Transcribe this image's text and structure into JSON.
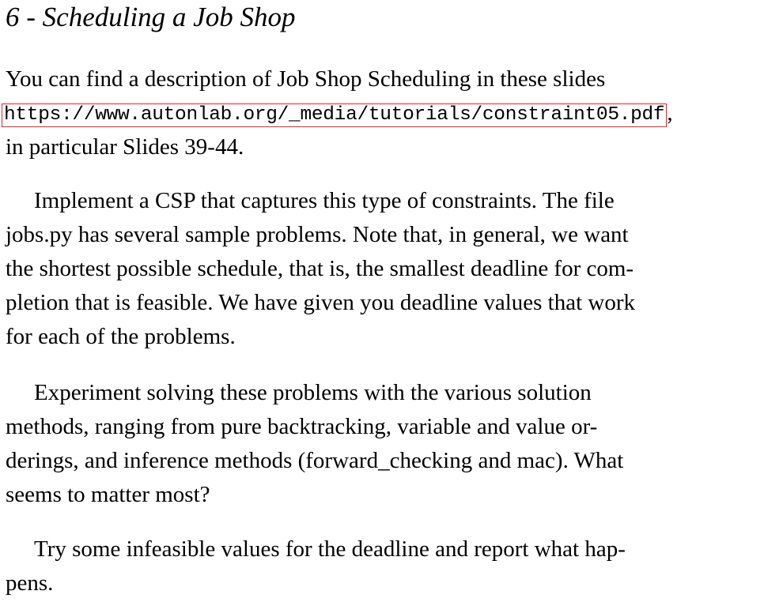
{
  "section": {
    "title": "6 - Scheduling a Job Shop"
  },
  "para1": {
    "line1": "You can find a description of Job Shop Scheduling in these slides",
    "url": "https://www.autonlab.org/_media/tutorials/constraint05.pdf",
    "url_after": ",",
    "line3": "in particular Slides 39-44."
  },
  "para2": {
    "line1": "Implement a CSP that captures this type of constraints. The file",
    "line2": "jobs.py has several sample problems. Note that, in general, we want",
    "line3": "the shortest possible schedule, that is, the smallest deadline for com-",
    "line4": "pletion that is feasible. We have given you deadline values that work",
    "line5": "for each of the problems."
  },
  "para3": {
    "line1": "Experiment solving these problems with the various solution",
    "line2": "methods, ranging from pure backtracking, variable and value or-",
    "line3": "derings, and inference methods (forward_checking and mac). What",
    "line4": "seems to matter most?"
  },
  "para4": {
    "line1": "Try some infeasible values for the deadline and report what hap-",
    "line2": "pens."
  },
  "colors": {
    "link_border": "#e0262a",
    "text": "#000000",
    "background": "#ffffff"
  }
}
